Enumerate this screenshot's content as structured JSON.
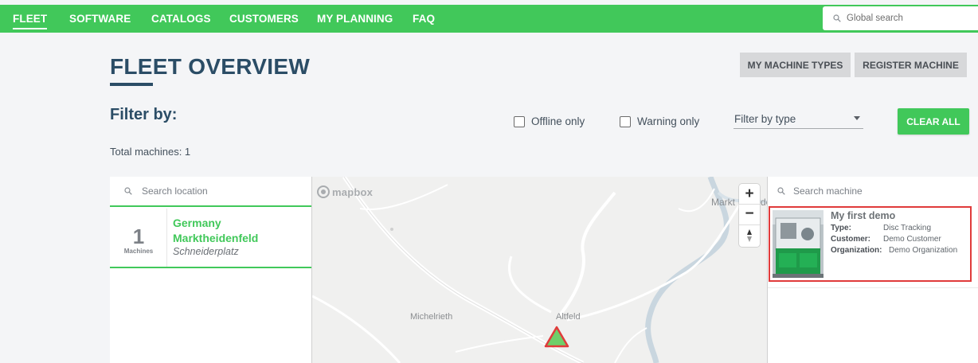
{
  "nav": {
    "items": [
      "FLEET",
      "SOFTWARE",
      "CATALOGS",
      "CUSTOMERS",
      "MY PLANNING",
      "FAQ"
    ],
    "active": "FLEET",
    "search_placeholder": "Global search"
  },
  "header": {
    "title": "FLEET OVERVIEW",
    "my_machine_types_label": "MY MACHINE TYPES",
    "register_machine_label": "REGISTER MACHINE"
  },
  "filters": {
    "title": "Filter by:",
    "offline_only_label": "Offline only",
    "warning_only_label": "Warning only",
    "filter_type_label": "Filter by type",
    "clear_all_label": "CLEAR ALL",
    "offline_only_checked": false,
    "warning_only_checked": false
  },
  "total_machines_text": "Total machines: 1",
  "locations": {
    "search_placeholder": "Search location",
    "items": [
      {
        "count": "1",
        "count_label": "Machines",
        "country": "Germany",
        "city": "Marktheidenfeld",
        "street": "Schneiderplatz"
      }
    ]
  },
  "map": {
    "attribution": "mapbox",
    "places": [
      "Michelrieth",
      "Altfeld",
      "Markt",
      "de"
    ],
    "zoom_in": "+",
    "zoom_out": "−",
    "marker_status_color": "#e03b3b",
    "marker_fill_color": "#6fcf6a"
  },
  "machines": {
    "search_placeholder": "Search machine",
    "items": [
      {
        "name": "My first demo",
        "type_label": "Type:",
        "type": "Disc Tracking",
        "customer_label": "Customer:",
        "customer": "Demo Customer",
        "organization_label": "Organization:",
        "organization": "Demo Organization"
      }
    ]
  },
  "colors": {
    "brand_green": "#41c85a",
    "title_blue": "#2b4d66",
    "selected_border": "#e03b3b"
  }
}
